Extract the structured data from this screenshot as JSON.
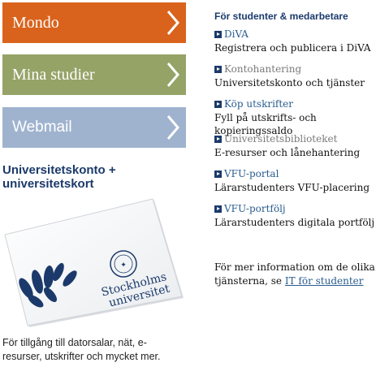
{
  "tiles": [
    {
      "label": "Mondo",
      "color": "#d9631c"
    },
    {
      "label": "Mina studier",
      "color": "#95a367"
    },
    {
      "label": "Webmail",
      "color": "#9fb3cf"
    }
  ],
  "left": {
    "heading": "Universitetskonto + universitetskort",
    "card_logo_line1": "Stockholms",
    "card_logo_line2": "universitet",
    "description": "För tillgång till datorsalar, nät, e-resurser, utskrifter och mycket mer."
  },
  "right": {
    "title": "För studenter & medarbetare",
    "services": [
      {
        "link": "DiVA",
        "desc": "Registrera och publicera i DiVA",
        "muted": false
      },
      {
        "link": "Kontohantering",
        "desc": "Universitetskonto och tjänster",
        "muted": true
      },
      {
        "link": "Köp utskrifter",
        "desc": "Fyll på utskrifts- och kopieringssaldo",
        "muted": false
      },
      {
        "link": "Universitetsbiblioteket",
        "desc": "E-resurser och lånehantering",
        "muted": true
      },
      {
        "link": "VFU-portal",
        "desc": "Lärarstudenters VFU-placering",
        "muted": false
      },
      {
        "link": "VFU-portfölj",
        "desc": "Lärarstudenters digitala portfölj",
        "muted": false
      }
    ],
    "more_text": "För mer information om de olika tjänsterna, se ",
    "more_link": "IT för studenter"
  },
  "colors": {
    "accent_blue": "#1b3a6b",
    "link": "#2a5d8f"
  }
}
